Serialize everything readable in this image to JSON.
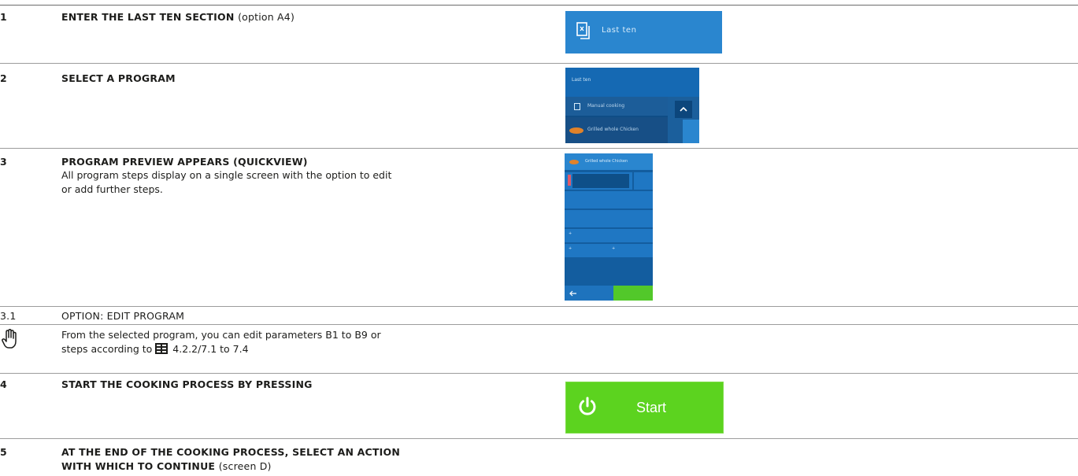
{
  "steps": [
    {
      "number": "1",
      "title": "ENTER THE LAST TEN SECTION",
      "suffix": "(option A4)"
    },
    {
      "number": "2",
      "title": "SELECT A PROGRAM"
    },
    {
      "number": "3",
      "title": "PROGRAM PREVIEW APPEARS (QUICKVIEW)",
      "description_line1": "All program steps display on a single screen with the option to edit",
      "description_line2": "or add further steps."
    },
    {
      "number": "3.1",
      "title": "OPTION: EDIT PROGRAM",
      "description_line1": "From the selected program, you can edit parameters B1 to B9 or",
      "description_line2_before_icon": "steps according to",
      "description_line2_after_icon": "4.2.2/7.1 to 7.4"
    },
    {
      "number": "4",
      "title": "START THE COOKING PROCESS BY PRESSING"
    },
    {
      "number": "5",
      "title_line1": "AT THE END OF THE COOKING PROCESS, SELECT AN ACTION",
      "title_line2": "WITH WHICH TO CONTINUE",
      "suffix": "(screen D)"
    }
  ],
  "screens": {
    "last_ten_tile_label": "Last ten",
    "select_program": {
      "header": "Last ten",
      "items": [
        "Manual cooking",
        "Grilled whole Chicken"
      ]
    },
    "quickview_header": "Grilled whole Chicken",
    "start_button_label": "Start"
  },
  "colors": {
    "tile_blue": "#2a86cf",
    "dark_blue": "#0f4d86",
    "start_green": "#5cd31f"
  },
  "icons": [
    "last-ten-icon",
    "chevron-up-icon",
    "hand-note-icon",
    "manual-reference-icon",
    "power-icon"
  ]
}
